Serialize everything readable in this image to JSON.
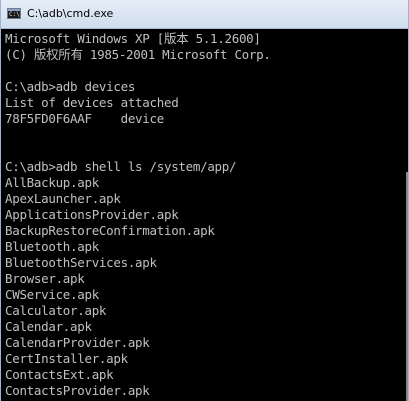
{
  "window": {
    "title": "C:\\adb\\cmd.exe",
    "icon": "cmd-console-icon",
    "icon_glyph": "C:\\"
  },
  "console": {
    "background": "#000000",
    "text_color": "#c0c0c0",
    "lines": [
      "Microsoft Windows XP [版本 5.1.2600]",
      "(C) 版权所有 1985-2001 Microsoft Corp.",
      "",
      "C:\\adb>adb devices",
      "List of devices attached",
      "78F5FD0F6AAF    device",
      "",
      "",
      "C:\\adb>adb shell ls /system/app/",
      "AllBackup.apk",
      "ApexLauncher.apk",
      "ApplicationsProvider.apk",
      "BackupRestoreConfirmation.apk",
      "Bluetooth.apk",
      "BluetoothServices.apk",
      "Browser.apk",
      "CWService.apk",
      "Calculator.apk",
      "Calendar.apk",
      "CalendarProvider.apk",
      "CertInstaller.apk",
      "ContactsExt.apk",
      "ContactsProvider.apk"
    ]
  }
}
